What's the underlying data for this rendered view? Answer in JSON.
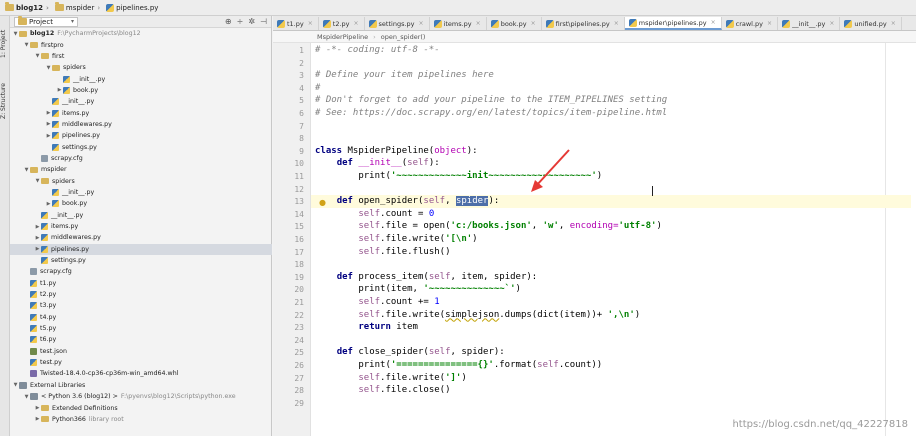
{
  "breadcrumb": {
    "items": [
      {
        "label": "blog12",
        "icon": "folder-icon"
      },
      {
        "label": "mspider",
        "icon": "folder-icon"
      },
      {
        "label": "pipelines.py",
        "icon": "python-file-icon"
      }
    ]
  },
  "toolstrip": {
    "project_tab": "1: Project",
    "structure_tab": "Z: Structure"
  },
  "project_panel": {
    "view_select": "Project",
    "tools": [
      "⊕",
      "÷",
      "✲",
      "⊣"
    ],
    "tree": [
      {
        "label": "blog12",
        "suffix": "F:\\PycharmProjects\\blog12",
        "indent": 0,
        "arrow": "down",
        "icon": "folder",
        "bold": true
      },
      {
        "label": "firstpro",
        "indent": 1,
        "arrow": "down",
        "icon": "folder"
      },
      {
        "label": "first",
        "indent": 2,
        "arrow": "down",
        "icon": "folder"
      },
      {
        "label": "spiders",
        "indent": 3,
        "arrow": "down",
        "icon": "folder"
      },
      {
        "label": "__init__.py",
        "indent": 4,
        "arrow": "",
        "icon": "py"
      },
      {
        "label": "book.py",
        "indent": 4,
        "arrow": "right",
        "icon": "py"
      },
      {
        "label": "__init__.py",
        "indent": 3,
        "arrow": "",
        "icon": "py"
      },
      {
        "label": "items.py",
        "indent": 3,
        "arrow": "right",
        "icon": "py"
      },
      {
        "label": "middlewares.py",
        "indent": 3,
        "arrow": "right",
        "icon": "py"
      },
      {
        "label": "pipelines.py",
        "indent": 3,
        "arrow": "right",
        "icon": "py"
      },
      {
        "label": "settings.py",
        "indent": 3,
        "arrow": "",
        "icon": "py"
      },
      {
        "label": "scrapy.cfg",
        "indent": 2,
        "arrow": "",
        "icon": "cfg"
      },
      {
        "label": "mspider",
        "indent": 1,
        "arrow": "down",
        "icon": "folder"
      },
      {
        "label": "spiders",
        "indent": 2,
        "arrow": "down",
        "icon": "folder"
      },
      {
        "label": "__init__.py",
        "indent": 3,
        "arrow": "",
        "icon": "py"
      },
      {
        "label": "book.py",
        "indent": 3,
        "arrow": "right",
        "icon": "py"
      },
      {
        "label": "__init__.py",
        "indent": 2,
        "arrow": "",
        "icon": "py"
      },
      {
        "label": "items.py",
        "indent": 2,
        "arrow": "right",
        "icon": "py"
      },
      {
        "label": "middlewares.py",
        "indent": 2,
        "arrow": "right",
        "icon": "py"
      },
      {
        "label": "pipelines.py",
        "indent": 2,
        "arrow": "right",
        "icon": "py",
        "selected": true
      },
      {
        "label": "settings.py",
        "indent": 2,
        "arrow": "",
        "icon": "py"
      },
      {
        "label": "scrapy.cfg",
        "indent": 1,
        "arrow": "",
        "icon": "cfg"
      },
      {
        "label": "t1.py",
        "indent": 1,
        "arrow": "",
        "icon": "py"
      },
      {
        "label": "t2.py",
        "indent": 1,
        "arrow": "",
        "icon": "py"
      },
      {
        "label": "t3.py",
        "indent": 1,
        "arrow": "",
        "icon": "py"
      },
      {
        "label": "t4.py",
        "indent": 1,
        "arrow": "",
        "icon": "py"
      },
      {
        "label": "t5.py",
        "indent": 1,
        "arrow": "",
        "icon": "py"
      },
      {
        "label": "t6.py",
        "indent": 1,
        "arrow": "",
        "icon": "py"
      },
      {
        "label": "test.json",
        "indent": 1,
        "arrow": "",
        "icon": "json"
      },
      {
        "label": "test.py",
        "indent": 1,
        "arrow": "",
        "icon": "py"
      },
      {
        "label": "Twisted-18.4.0-cp36-cp36m-win_amd64.whl",
        "indent": 1,
        "arrow": "",
        "icon": "whl"
      },
      {
        "label": "External Libraries",
        "indent": 0,
        "arrow": "down",
        "icon": "lib"
      },
      {
        "label": "< Python 3.6 (blog12) >",
        "suffix": "F:\\pyenvs\\blog12\\Scripts\\python.exe",
        "indent": 1,
        "arrow": "down",
        "icon": "lib"
      },
      {
        "label": "Extended Definitions",
        "indent": 2,
        "arrow": "right",
        "icon": "folder"
      },
      {
        "label": "Python366",
        "suffix": "library root",
        "indent": 2,
        "arrow": "right",
        "icon": "folder"
      }
    ]
  },
  "editor_tabs": [
    {
      "label": "t1.py",
      "active": false
    },
    {
      "label": "t2.py",
      "active": false
    },
    {
      "label": "settings.py",
      "active": false
    },
    {
      "label": "items.py",
      "active": false
    },
    {
      "label": "book.py",
      "active": false
    },
    {
      "label": "first\\pipelines.py",
      "active": false
    },
    {
      "label": "mspider\\pipelines.py",
      "active": true
    },
    {
      "label": "crawl.py",
      "active": false
    },
    {
      "label": "__init__.py",
      "active": false
    },
    {
      "label": "unified.py",
      "active": false
    }
  ],
  "tab_close_glyph": "×",
  "editor_breadcrumb": [
    "MspiderPipeline",
    "open_spider()"
  ],
  "editor": {
    "current_line": 13,
    "line_numbers": [
      "1",
      "2",
      "3",
      "4",
      "5",
      "6",
      "7",
      "8",
      "9",
      "10",
      "11",
      "12",
      "13",
      "14",
      "15",
      "16",
      "17",
      "18",
      "19",
      "20",
      "21",
      "22",
      "23",
      "24",
      "25",
      "26",
      "27",
      "28",
      "29"
    ],
    "lines": [
      [
        {
          "t": "# -*- coding: utf-8 -*-",
          "c": "cm"
        }
      ],
      [],
      [
        {
          "t": "# Define your item pipelines here",
          "c": "cm"
        }
      ],
      [
        {
          "t": "#",
          "c": "cm"
        }
      ],
      [
        {
          "t": "# Don't forget to add your pipeline to the ITEM_PIPELINES setting",
          "c": "cm"
        }
      ],
      [
        {
          "t": "# See: https://doc.scrapy.org/en/latest/topics/item-pipeline.html",
          "c": "cm"
        }
      ],
      [],
      [],
      [
        {
          "t": "class ",
          "c": "kw"
        },
        {
          "t": "MspiderPipeline(",
          "c": ""
        },
        {
          "t": "object",
          "c": "dn"
        },
        {
          "t": "):",
          "c": ""
        }
      ],
      [
        {
          "t": "    ",
          "c": ""
        },
        {
          "t": "def ",
          "c": "kw"
        },
        {
          "t": "__init__",
          "c": "dn"
        },
        {
          "t": "(",
          "c": ""
        },
        {
          "t": "self",
          "c": "sf"
        },
        {
          "t": "):",
          "c": ""
        }
      ],
      [
        {
          "t": "        print(",
          "c": ""
        },
        {
          "t": "'~~~~~~~~~~~~~init~~~~~~~~~~~~~~~~~~~'",
          "c": "st"
        },
        {
          "t": ")",
          "c": ""
        }
      ],
      [],
      [
        {
          "t": "    ",
          "c": ""
        },
        {
          "t": "def ",
          "c": "kw"
        },
        {
          "t": "open_spider(",
          "c": ""
        },
        {
          "t": "self",
          "c": "sf"
        },
        {
          "t": ", ",
          "c": ""
        },
        {
          "t": "spider",
          "c": "hl"
        },
        {
          "t": "):",
          "c": ""
        }
      ],
      [
        {
          "t": "        ",
          "c": ""
        },
        {
          "t": "self",
          "c": "sf"
        },
        {
          "t": ".count = ",
          "c": ""
        },
        {
          "t": "0",
          "c": "nm"
        }
      ],
      [
        {
          "t": "        ",
          "c": ""
        },
        {
          "t": "self",
          "c": "sf"
        },
        {
          "t": ".file = open(",
          "c": ""
        },
        {
          "t": "'c:/books.json'",
          "c": "st"
        },
        {
          "t": ", ",
          "c": ""
        },
        {
          "t": "'w'",
          "c": "st"
        },
        {
          "t": ", ",
          "c": ""
        },
        {
          "t": "encoding=",
          "c": "dn"
        },
        {
          "t": "'utf-8'",
          "c": "st"
        },
        {
          "t": ")",
          "c": ""
        }
      ],
      [
        {
          "t": "        ",
          "c": ""
        },
        {
          "t": "self",
          "c": "sf"
        },
        {
          "t": ".file.write(",
          "c": ""
        },
        {
          "t": "'[\\n'",
          "c": "st"
        },
        {
          "t": ")",
          "c": ""
        }
      ],
      [
        {
          "t": "        ",
          "c": ""
        },
        {
          "t": "self",
          "c": "sf"
        },
        {
          "t": ".file.flush()",
          "c": ""
        }
      ],
      [],
      [
        {
          "t": "    ",
          "c": ""
        },
        {
          "t": "def ",
          "c": "kw"
        },
        {
          "t": "process_item(",
          "c": ""
        },
        {
          "t": "self",
          "c": "sf"
        },
        {
          "t": ", item, spider):",
          "c": ""
        }
      ],
      [
        {
          "t": "        print(item, ",
          "c": ""
        },
        {
          "t": "'~~~~~~~~~~~~~~`'",
          "c": "st"
        },
        {
          "t": ")",
          "c": ""
        }
      ],
      [
        {
          "t": "        ",
          "c": ""
        },
        {
          "t": "self",
          "c": "sf"
        },
        {
          "t": ".count += ",
          "c": ""
        },
        {
          "t": "1",
          "c": "nm"
        }
      ],
      [
        {
          "t": "        ",
          "c": ""
        },
        {
          "t": "self",
          "c": "sf"
        },
        {
          "t": ".file.write(",
          "c": ""
        },
        {
          "t": "simplejson",
          "c": "sq"
        },
        {
          "t": ".dumps(dict(item))+ ",
          "c": ""
        },
        {
          "t": "',\\n'",
          "c": "st"
        },
        {
          "t": ")",
          "c": ""
        }
      ],
      [
        {
          "t": "        ",
          "c": ""
        },
        {
          "t": "return ",
          "c": "kw"
        },
        {
          "t": "item",
          "c": ""
        }
      ],
      [],
      [
        {
          "t": "    ",
          "c": ""
        },
        {
          "t": "def ",
          "c": "kw"
        },
        {
          "t": "close_spider(",
          "c": ""
        },
        {
          "t": "self",
          "c": "sf"
        },
        {
          "t": ", spider):",
          "c": ""
        }
      ],
      [
        {
          "t": "        print(",
          "c": ""
        },
        {
          "t": "'==============={}'",
          "c": "st"
        },
        {
          "t": ".format(",
          "c": ""
        },
        {
          "t": "self",
          "c": "sf"
        },
        {
          "t": ".count))",
          "c": ""
        }
      ],
      [
        {
          "t": "        ",
          "c": ""
        },
        {
          "t": "self",
          "c": "sf"
        },
        {
          "t": ".file.write(",
          "c": ""
        },
        {
          "t": "']'",
          "c": "st"
        },
        {
          "t": ")",
          "c": ""
        }
      ],
      [
        {
          "t": "        ",
          "c": ""
        },
        {
          "t": "self",
          "c": "sf"
        },
        {
          "t": ".file.close()",
          "c": ""
        }
      ],
      []
    ]
  },
  "watermark": "https://blog.csdn.net/qq_42227818",
  "colors": {
    "annotation_arrow": "#e53935",
    "selection": "#4d6ea8",
    "current_line": "#fffbdc"
  }
}
